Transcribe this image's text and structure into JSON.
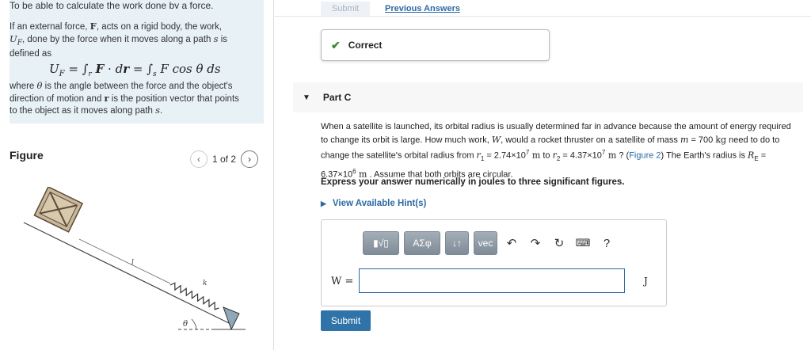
{
  "left": {
    "intro_cut": "To be able to calculate the work done by a force.",
    "p1": "If an external force, F, acts on a rigid body, the work, U_F, done by the force when it moves along a path s is defined as",
    "formula": "U_F = ∫_r F · dr = ∫_s F cos θ ds",
    "p2": "where θ is the angle between the force and the object's direction of motion and r is the position vector that points to the object as it moves along path s.",
    "figure_label": "Figure",
    "pager_text": "1 of 2",
    "figure_labels": {
      "l": "l",
      "k": "k",
      "theta": "θ"
    }
  },
  "top": {
    "submit_label": "Submit",
    "previous_answers": "Previous Answers"
  },
  "correct": {
    "label": "Correct"
  },
  "part": {
    "title": "Part C"
  },
  "question": {
    "t1": "When a satellite is launched, its orbital radius is usually determined far in advance because the amount of energy required to change its orbit is large. How much work, ",
    "W": "W",
    "t2": ", would a rocket thruster on a satellite of mass ",
    "m": "m",
    "t3": " = 700 ",
    "kg": "kg",
    "t4": " need to do to change the satellite's orbital radius from ",
    "r1": "r",
    "r1_sub": "1",
    "t5": " = 2.74×10",
    "r1_exp": "7",
    "m_unit": " m",
    "t6": " to ",
    "r2": "r",
    "r2_sub": "2",
    "t7": " = 4.37×10",
    "r2_exp": "7",
    "m_unit2": " m",
    "t8": " ? (",
    "fig_link": "Figure 2",
    "t9": ") The Earth's radius is ",
    "RE": "R",
    "RE_sub": "E",
    "t10": " = 6.37×10",
    "RE_exp": "6",
    "m_unit3": " m",
    "t11": " . Assume that both orbits are circular."
  },
  "express": "Express your answer numerically in joules to three significant figures.",
  "hints": "View Available Hint(s)",
  "answer": {
    "toolbar": {
      "templates": "▮√▯",
      "symbols": "ΑΣφ",
      "arrows": "↓↑",
      "vec": "vec",
      "help": "?"
    },
    "w_label": "W =",
    "input_value": "",
    "unit": "J"
  },
  "submit": {
    "label": "Submit"
  }
}
